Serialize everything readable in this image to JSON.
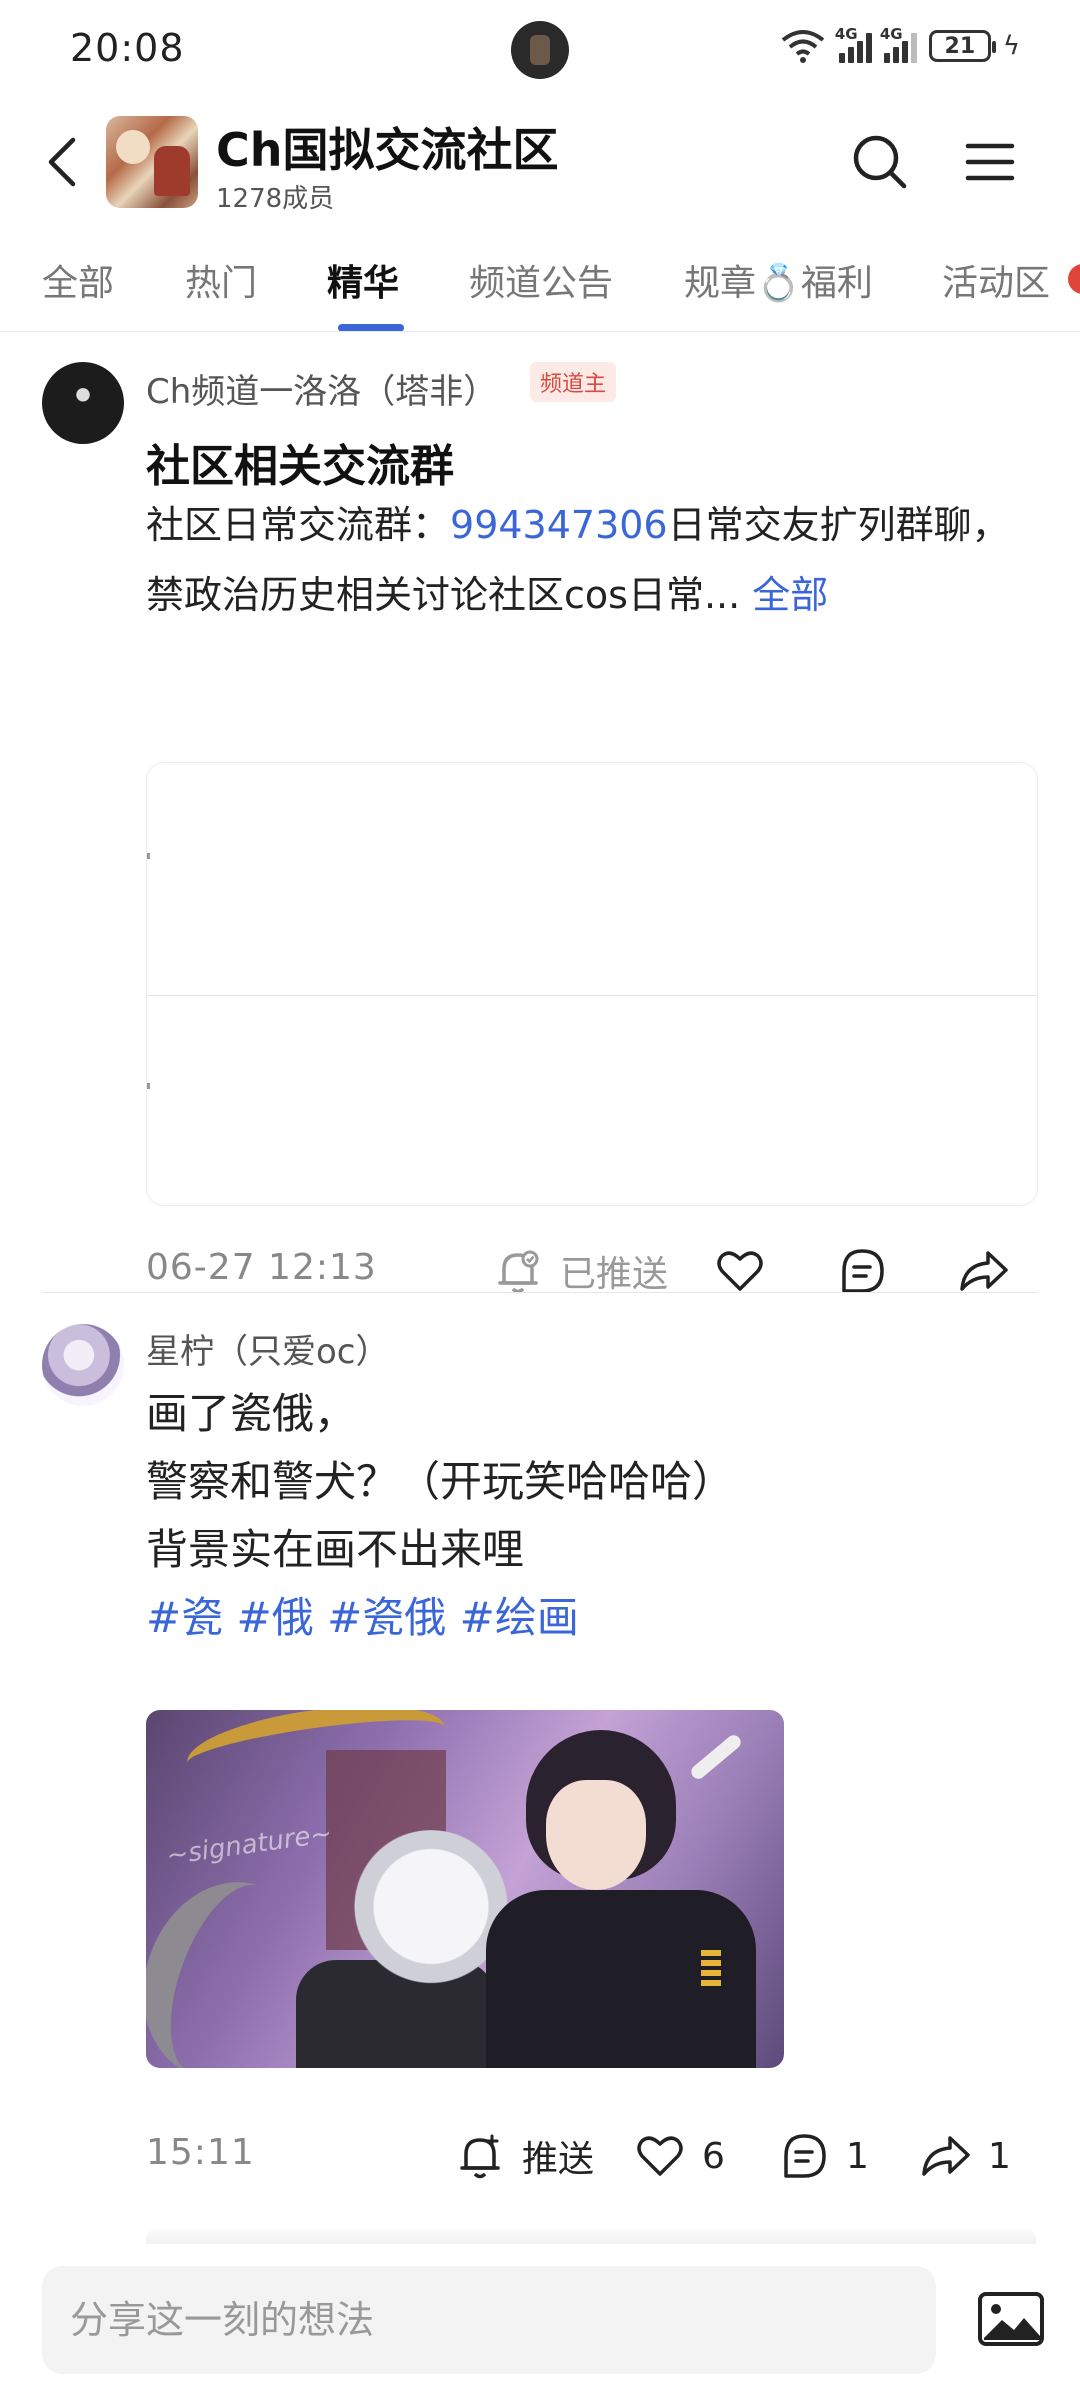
{
  "status_bar": {
    "time": "20:08",
    "network_1": "4G",
    "network_2": "4G",
    "battery": "21"
  },
  "header": {
    "title": "Ch国拟交流社区",
    "members": "1278成员"
  },
  "tabs": [
    {
      "label": "全部"
    },
    {
      "label": "热门"
    },
    {
      "label": "精华"
    },
    {
      "label": "频道公告"
    },
    {
      "label": "规章💍福利"
    },
    {
      "label": "活动区"
    }
  ],
  "posts": [
    {
      "author": "Ch频道一洛洛（塔非）",
      "badge": "频道主",
      "title": "社区相关交流群",
      "body_prefix": "社区日常交流群：",
      "body_link": "994347306",
      "body_rest": "日常交友扩列群聊，禁政治历史相关讨论社区cos日常...",
      "more": "全部",
      "timestamp": "06-27 12:13",
      "push_label": "已推送"
    },
    {
      "author": "星柠（只爱oc）",
      "lines": [
        "画了瓷俄，",
        "警察和警犬？（开玩笑哈哈哈）",
        "背景实在画不出来哩"
      ],
      "hashtags": "#瓷 #俄 #瓷俄 #绘画",
      "timestamp": "15:11",
      "push_label": "推送",
      "likes": "6",
      "comments": "1",
      "shares": "1"
    }
  ],
  "composer": {
    "placeholder": "分享这一刻的想法"
  },
  "colors": {
    "accent": "#3a66d8",
    "badge": "#d9493e"
  },
  "icons": [
    "back-arrow-icon",
    "search-icon",
    "menu-icon",
    "bell-icon",
    "heart-icon",
    "comment-icon",
    "share-icon",
    "image-icon"
  ]
}
